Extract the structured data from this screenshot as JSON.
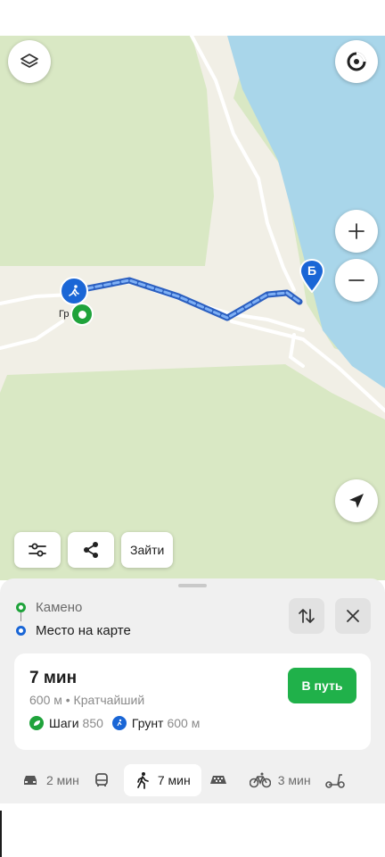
{
  "map": {
    "label_start": "Гр",
    "marker_dest": "Б",
    "colors": {
      "land": "#f1efe6",
      "forest": "#d9e8c4",
      "water": "#a9d6ea",
      "route": "#4a86e8",
      "start": "#1fa33b",
      "dest": "#1a66d6"
    },
    "controls": {
      "layers_icon": "layers-icon",
      "compass_icon": "compass-icon",
      "zoom_in_icon": "plus-icon",
      "zoom_out_icon": "minus-icon",
      "location_icon": "location-arrow-icon"
    }
  },
  "chips": {
    "settings_icon": "sliders-icon",
    "share_icon": "share-icon",
    "enter_label": "Зайти"
  },
  "route": {
    "from": "Камено",
    "to": "Место на карте",
    "swap_icon": "swap-icon",
    "close_icon": "close-icon"
  },
  "card": {
    "time": "7 мин",
    "subtitle": "600 м • Кратчайший",
    "go_label": "В путь",
    "steps_label": "Шаги",
    "steps_value": "850",
    "surface_label": "Грунт",
    "surface_value": "600 м"
  },
  "modes": [
    {
      "icon": "car-icon",
      "label": "2 мин"
    },
    {
      "icon": "bus-icon",
      "label": ""
    },
    {
      "icon": "walk-icon",
      "label": "7 мин"
    },
    {
      "icon": "taxi-icon",
      "label": ""
    },
    {
      "icon": "bicycle-icon",
      "label": "3 мин"
    },
    {
      "icon": "scooter-icon",
      "label": ""
    }
  ]
}
